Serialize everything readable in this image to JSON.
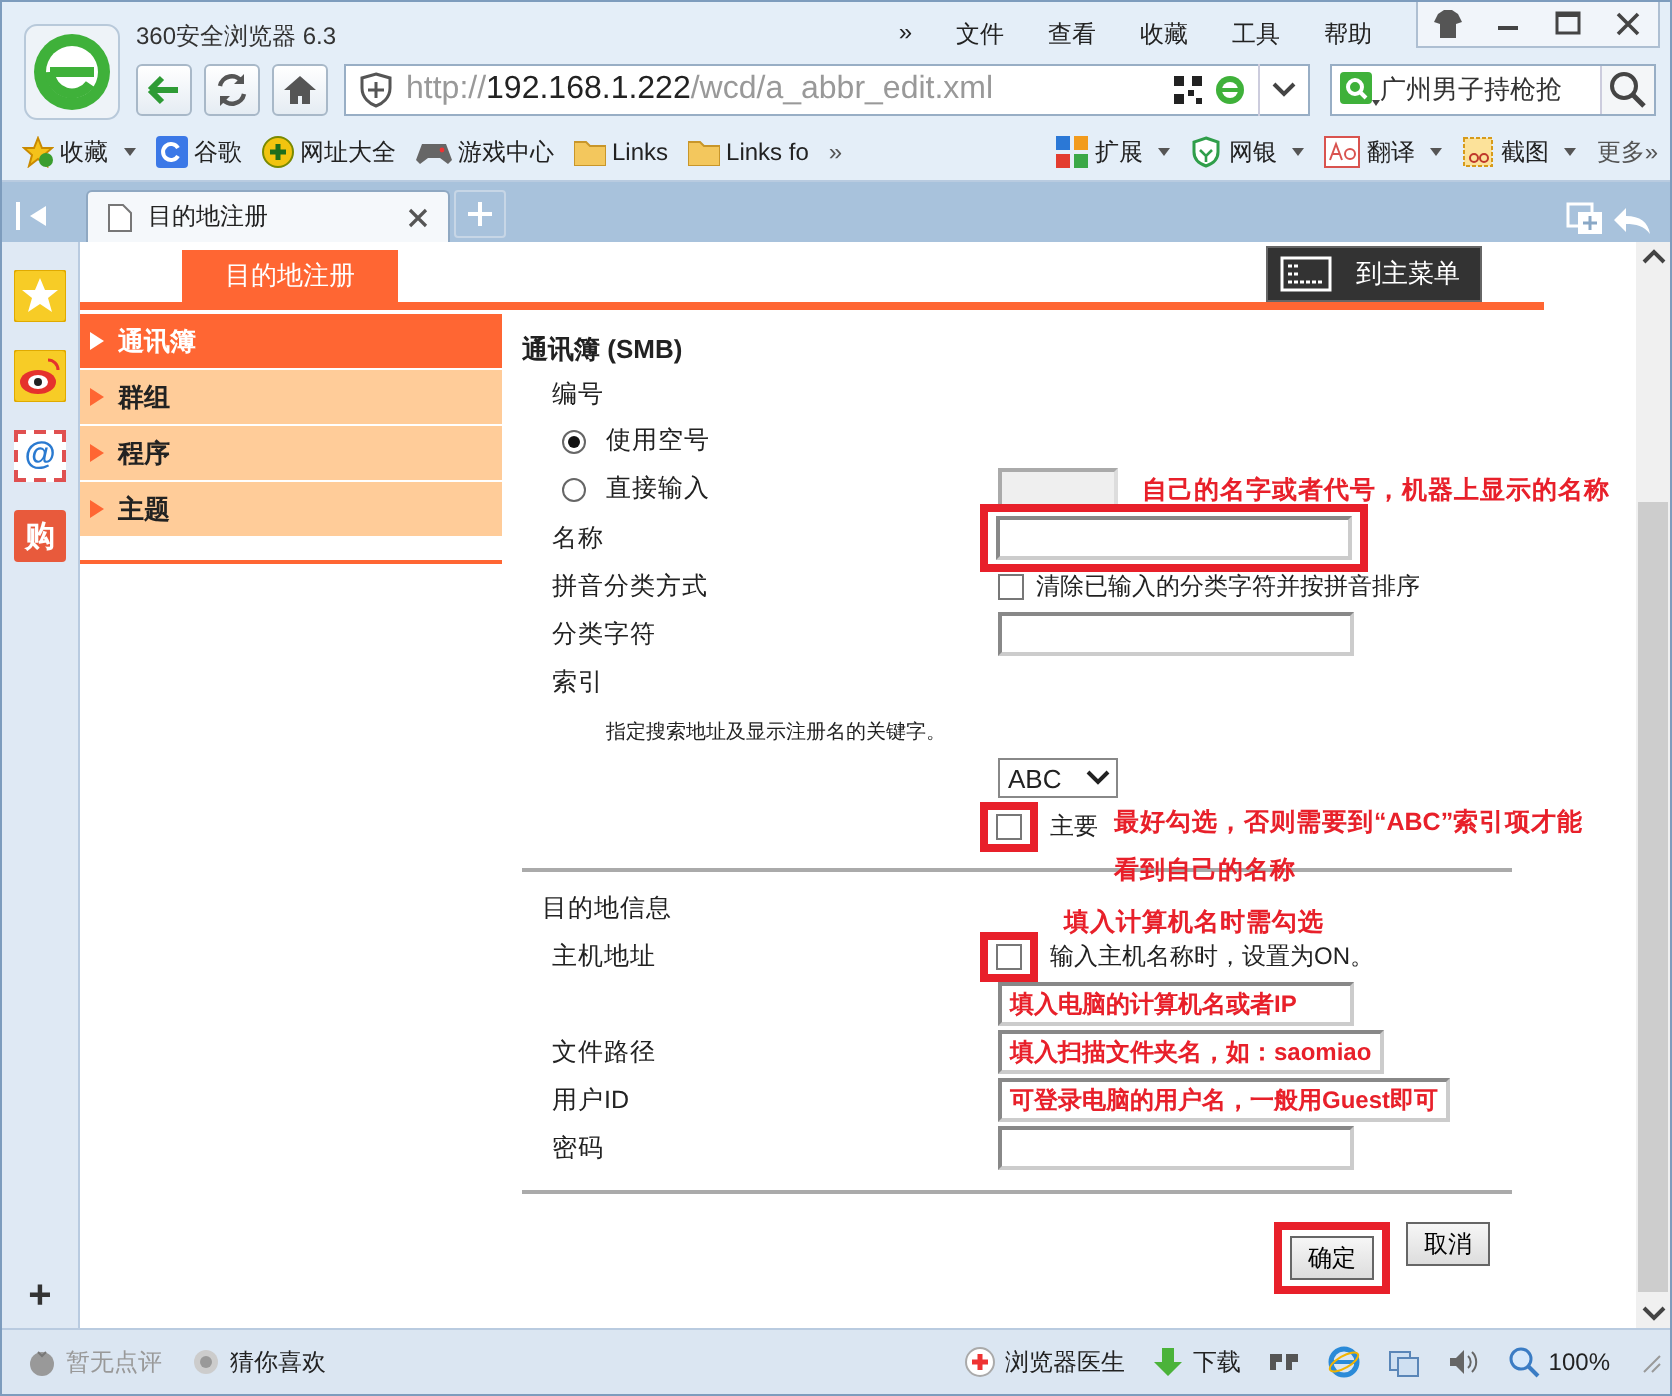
{
  "window": {
    "title": "360安全浏览器 6.3"
  },
  "menu": [
    {
      "label": "»"
    },
    {
      "label": "文件"
    },
    {
      "label": "查看"
    },
    {
      "label": "收藏"
    },
    {
      "label": "工具"
    },
    {
      "label": "帮助"
    }
  ],
  "address_bar": {
    "scheme": "http://",
    "host": "192.168.1.222",
    "path": "/wcd/a_abbr_edit.xml"
  },
  "search": {
    "value": "广州男子持枪抢"
  },
  "bookmarks": [
    {
      "label": "收藏",
      "kind": "star",
      "dropdown": true
    },
    {
      "label": "谷歌",
      "kind": "google",
      "dropdown": false
    },
    {
      "label": "网址大全",
      "kind": "plus",
      "dropdown": false
    },
    {
      "label": "游戏中心",
      "kind": "gamepad",
      "dropdown": false
    },
    {
      "label": "Links",
      "kind": "folder",
      "dropdown": false
    },
    {
      "label": "Links fo",
      "kind": "folder",
      "dropdown": false
    },
    {
      "label": "»",
      "kind": "text",
      "dropdown": false
    }
  ],
  "extensions": [
    {
      "label": "扩展",
      "kind": "grid",
      "dropdown": true
    },
    {
      "label": "网银",
      "kind": "shield",
      "dropdown": true
    },
    {
      "label": "翻译",
      "kind": "translate",
      "dropdown": true
    },
    {
      "label": "截图",
      "kind": "scissors",
      "dropdown": true
    },
    {
      "label": "更多»",
      "kind": "text",
      "dropdown": false
    }
  ],
  "tabs": [
    {
      "label": "目的地注册",
      "selected": true
    }
  ],
  "sidebar": [
    {
      "kind": "star"
    },
    {
      "kind": "weibo"
    },
    {
      "kind": "mail",
      "glyph": "@"
    },
    {
      "kind": "shop",
      "glyph": "购"
    }
  ],
  "sidebar_add": "+",
  "page": {
    "tabs": [
      {
        "label": "目的地注册",
        "selected": true
      }
    ],
    "main_menu_button": "到主菜单",
    "menu": [
      {
        "label": "通讯簿",
        "selected": true
      },
      {
        "label": "群组",
        "selected": false
      },
      {
        "label": "程序",
        "selected": false
      },
      {
        "label": "主题",
        "selected": false
      }
    ],
    "form": {
      "heading": "通讯簿 (SMB)",
      "rows": [
        {
          "kind": "label",
          "label": "编号"
        },
        {
          "kind": "radio",
          "label": "使用空号",
          "selected": true
        },
        {
          "kind": "radio",
          "label": "直接输入",
          "selected": false,
          "field_disabled": true
        },
        {
          "kind": "input",
          "label": "名称",
          "highlighted": true
        },
        {
          "kind": "checkbox",
          "label": "拼音分类方式",
          "option": "清除已输入的分类字符并按拼音排序",
          "checked": false
        },
        {
          "kind": "input",
          "label": "分类字符"
        },
        {
          "kind": "label",
          "label": "索引"
        },
        {
          "kind": "note",
          "label": "指定搜索地址及显示注册名的关键字。"
        },
        {
          "kind": "select",
          "value": "ABC"
        },
        {
          "kind": "checkbox",
          "option": "主要",
          "checked": false,
          "highlighted": true
        },
        {
          "kind": "rule"
        },
        {
          "kind": "section",
          "label": "目的地信息"
        },
        {
          "kind": "checkbox",
          "label": "主机地址",
          "option": "输入主机名称时，设置为ON。",
          "checked": false,
          "highlighted": true
        },
        {
          "kind": "input",
          "annotation": "填入电脑的计算机名或者IP"
        },
        {
          "kind": "input",
          "label": "文件路径",
          "annotation": "填入扫描文件夹名，如：saomiao"
        },
        {
          "kind": "input",
          "label": "用户ID",
          "annotation": "可登录电脑的用户名，一般用Guest即可"
        },
        {
          "kind": "input",
          "label": "密码"
        },
        {
          "kind": "rule"
        }
      ],
      "buttons": [
        {
          "label": "确定",
          "highlighted": true
        },
        {
          "label": "取消",
          "highlighted": false
        }
      ]
    }
  },
  "annotations": [
    {
      "kind": "note",
      "text": "自己的名字或者代号，机器上显示的名称"
    },
    {
      "kind": "note",
      "text": "最好勾选，否则需要到“ABC”索引项才能"
    },
    {
      "kind": "note",
      "text": "看到自己的名称"
    },
    {
      "kind": "note",
      "text": "填入计算机名时需勾选"
    }
  ],
  "status_bar": {
    "left": [
      {
        "label": "暂无点评",
        "kind": "rating",
        "disabled": true
      },
      {
        "label": "猜你喜欢",
        "kind": "dot",
        "disabled": false
      }
    ],
    "right": [
      {
        "label": "浏览器医生",
        "kind": "doctor"
      },
      {
        "label": "下载",
        "kind": "download"
      },
      {
        "kind": "p2p"
      },
      {
        "kind": "ie"
      },
      {
        "kind": "windows"
      },
      {
        "kind": "sound"
      },
      {
        "label": "100%",
        "kind": "zoom"
      }
    ]
  }
}
